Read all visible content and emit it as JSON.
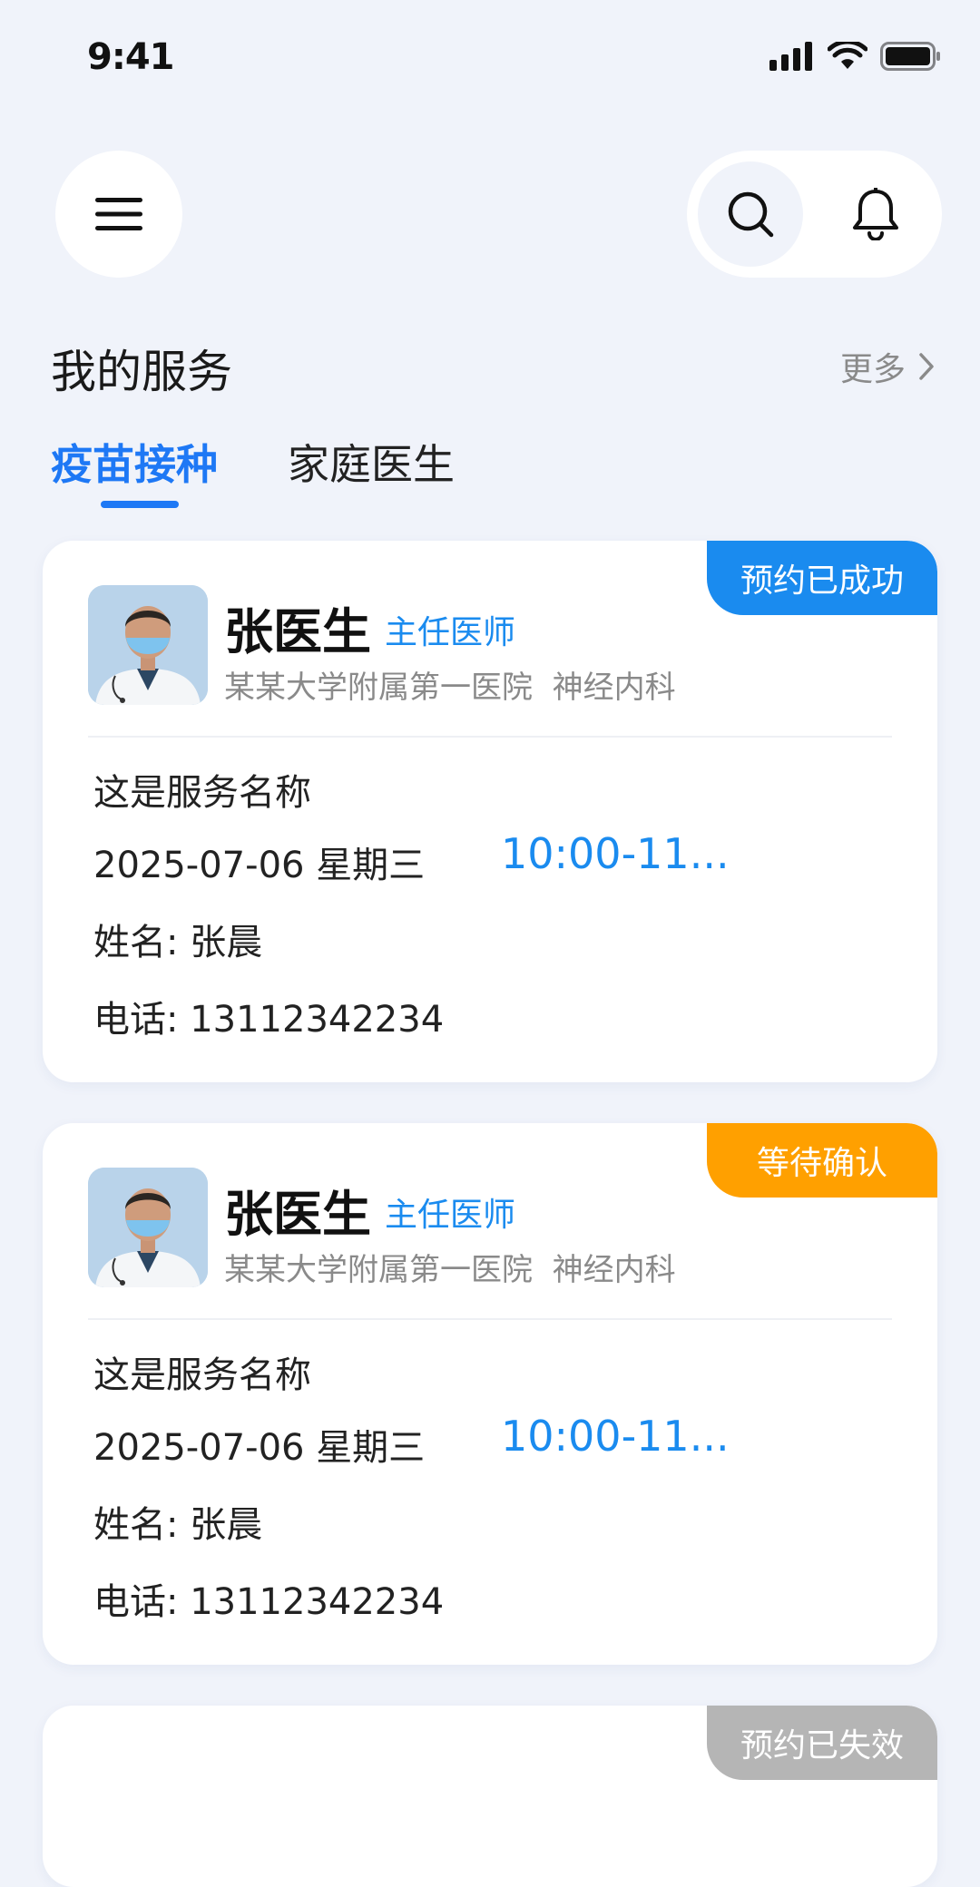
{
  "status_bar": {
    "time": "9:41",
    "icons": [
      "signal-icon",
      "wifi-icon",
      "battery-icon"
    ]
  },
  "header": {
    "menu_icon": "menu-icon",
    "search_icon": "search-icon",
    "bell_icon": "bell-icon"
  },
  "section": {
    "title": "我的服务",
    "more_label": "更多"
  },
  "tabs": [
    {
      "label": "疫苗接种",
      "active": true
    },
    {
      "label": "家庭医生",
      "active": false
    }
  ],
  "colors": {
    "accent": "#1e78f5",
    "success": "#1a8bef",
    "pending": "#ffa000",
    "expired": "#b5b5b5",
    "background": "#f0f3fa"
  },
  "cards": [
    {
      "status": "预约已成功",
      "status_color": "#1a8bef",
      "doctor_name": "张医生",
      "doctor_title": "主任医师",
      "hospital": "某某大学附属第一医院",
      "department": "神经内科",
      "service_name": "这是服务名称",
      "date": "2025-07-06",
      "weekday": "星期三",
      "time_slot": "10:00-11...",
      "patient_label": "姓名:",
      "patient_name": "张晨",
      "phone_label": "电话:",
      "phone": "13112342234"
    },
    {
      "status": "等待确认",
      "status_color": "#ffa000",
      "doctor_name": "张医生",
      "doctor_title": "主任医师",
      "hospital": "某某大学附属第一医院",
      "department": "神经内科",
      "service_name": "这是服务名称",
      "date": "2025-07-06",
      "weekday": "星期三",
      "time_slot": "10:00-11...",
      "patient_label": "姓名:",
      "patient_name": "张晨",
      "phone_label": "电话:",
      "phone": "13112342234"
    },
    {
      "status": "预约已失效",
      "status_color": "#b5b5b5"
    }
  ]
}
